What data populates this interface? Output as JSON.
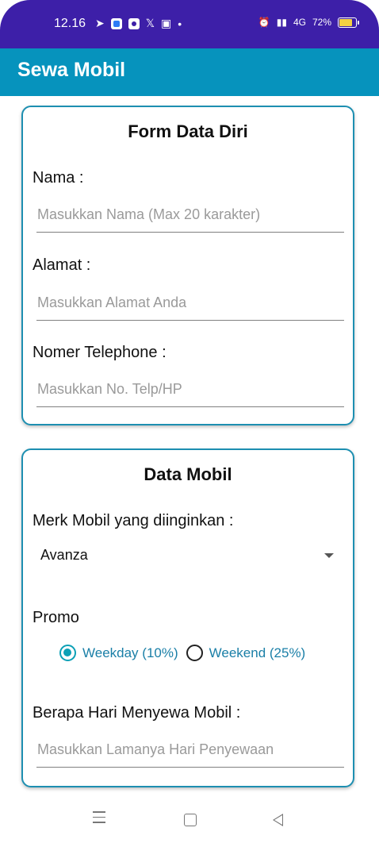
{
  "status_bar": {
    "time": "12.16",
    "battery": "72%",
    "network": "4G",
    "battery_fraction": 0.72
  },
  "app_bar": {
    "title": "Sewa Mobil"
  },
  "form_data_diri": {
    "title": "Form Data Diri",
    "nama": {
      "label": "Nama :",
      "placeholder": "Masukkan Nama (Max 20 karakter)",
      "value": ""
    },
    "alamat": {
      "label": "Alamat :",
      "placeholder": "Masukkan Alamat Anda",
      "value": ""
    },
    "telephone": {
      "label": "Nomer Telephone :",
      "placeholder": "Masukkan No. Telp/HP",
      "value": ""
    }
  },
  "data_mobil": {
    "title": "Data Mobil",
    "merk_label": "Merk Mobil yang diinginkan :",
    "merk_selected": "Avanza",
    "promo_label": "Promo",
    "promo_options": [
      {
        "label": "Weekday (10%)",
        "checked": true
      },
      {
        "label": "Weekend (25%)",
        "checked": false
      }
    ],
    "hari": {
      "label": "Berapa Hari Menyewa Mobil :",
      "placeholder": "Masukkan Lamanya Hari Penyewaan",
      "value": ""
    }
  },
  "colors": {
    "status_bar": "#3d1fa8",
    "app_bar": "#0693bd",
    "card_border": "#1d8fb1",
    "radio_accent": "#0ba0b6"
  },
  "icons": {
    "status_left": [
      "telegram-icon",
      "app-icon",
      "settings-icon",
      "x-icon",
      "android-icon",
      "dot-icon"
    ],
    "status_right": [
      "alarm-icon",
      "signal-icon",
      "battery-icon"
    ],
    "nav": [
      "menu-icon",
      "home-icon",
      "back-icon"
    ]
  }
}
